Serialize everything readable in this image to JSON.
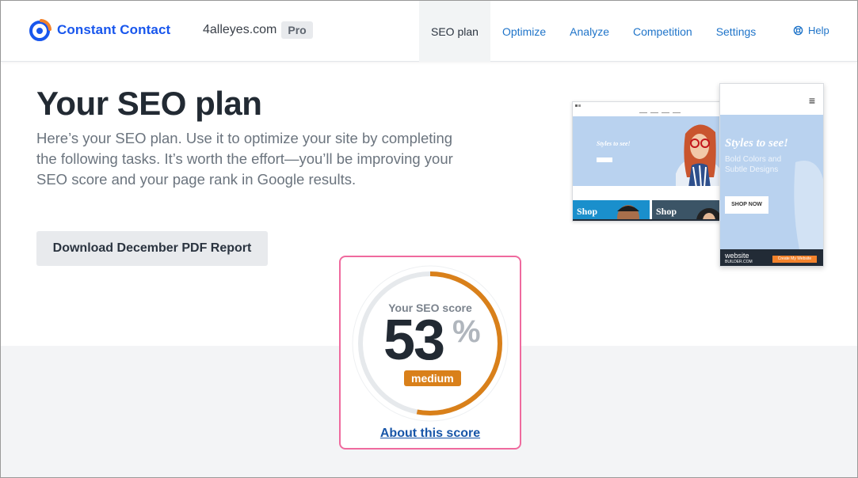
{
  "header": {
    "brand": "Constant Contact",
    "site_name": "4alleyes.com",
    "plan_badge": "Pro",
    "nav": [
      {
        "label": "SEO plan",
        "active": true
      },
      {
        "label": "Optimize",
        "active": false
      },
      {
        "label": "Analyze",
        "active": false
      },
      {
        "label": "Competition",
        "active": false
      },
      {
        "label": "Settings",
        "active": false
      }
    ],
    "help_label": "Help",
    "help_icon": "lifebuoy-icon"
  },
  "main": {
    "title": "Your SEO plan",
    "intro": "Here’s your SEO plan. Use it to optimize your site by completing the following tasks. It’s worth the effort—you’ll be improving your SEO score and your page rank in Google results.",
    "download_button": "Download December PDF Report"
  },
  "preview": {
    "desktop_hero_text": "Styles to see!",
    "tile_1": "Shop",
    "tile_2": "Shop",
    "mobile_title": "Styles to see!",
    "mobile_subtitle": "Bold Colors and Subtle Designs",
    "mobile_button": "SHOP NOW",
    "footer_brand_1": "website",
    "footer_brand_2": "BUILDER.COM",
    "footer_cta": "Create My Website"
  },
  "score": {
    "label": "Your SEO score",
    "value": "53",
    "unit": "%",
    "level": "medium",
    "fraction": 0.53,
    "about_link": "About this score"
  },
  "colors": {
    "brand_blue": "#1856ed",
    "link_blue": "#1f74c9",
    "score_orange": "#d9801a",
    "highlight_pink": "#ef6a9e"
  }
}
